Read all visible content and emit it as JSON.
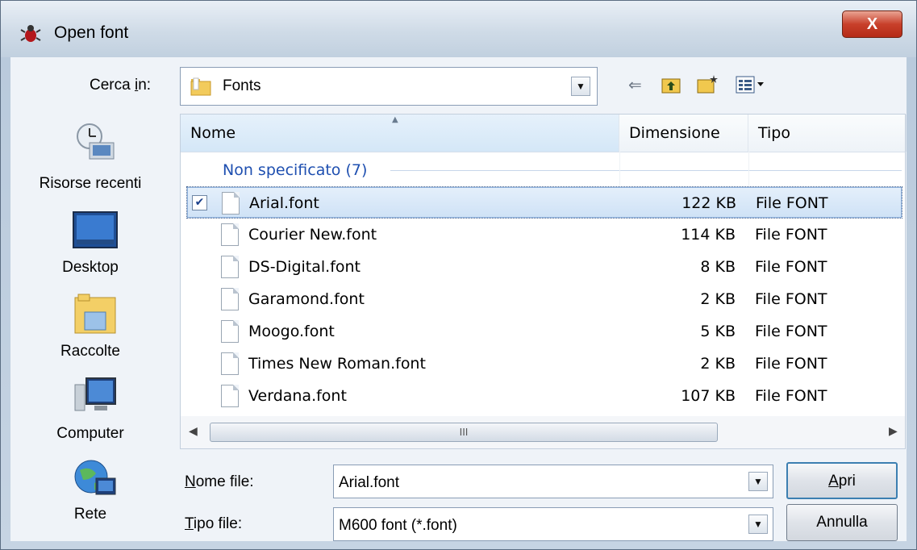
{
  "window": {
    "title": "Open font",
    "close_label": "X"
  },
  "toolbar": {
    "lookin_label_prefix": "Cerca ",
    "lookin_label_u": "i",
    "lookin_label_suffix": "n:",
    "lookin_value": "Fonts",
    "icons": [
      "back-arrow-icon",
      "up-folder-icon",
      "new-folder-icon",
      "view-menu-icon"
    ]
  },
  "places": [
    {
      "label": "Risorse recenti",
      "icon": "recent-places-icon"
    },
    {
      "label": "Desktop",
      "icon": "desktop-icon"
    },
    {
      "label": "Raccolte",
      "icon": "libraries-icon"
    },
    {
      "label": "Computer",
      "icon": "computer-icon"
    },
    {
      "label": "Rete",
      "icon": "network-icon"
    }
  ],
  "filelist": {
    "columns": [
      "Nome",
      "Dimensione",
      "Tipo"
    ],
    "group_label": "Non specificato (7)",
    "rows": [
      {
        "name": "Arial.font",
        "size": "122 KB",
        "type": "File FONT",
        "selected": true
      },
      {
        "name": "Courier New.font",
        "size": "114 KB",
        "type": "File FONT"
      },
      {
        "name": "DS-Digital.font",
        "size": "8 KB",
        "type": "File FONT"
      },
      {
        "name": "Garamond.font",
        "size": "2 KB",
        "type": "File FONT"
      },
      {
        "name": "Moogo.font",
        "size": "5 KB",
        "type": "File FONT"
      },
      {
        "name": "Times New Roman.font",
        "size": "2 KB",
        "type": "File FONT"
      },
      {
        "name": "Verdana.font",
        "size": "107 KB",
        "type": "File FONT"
      }
    ],
    "scroll_thumb_label": "III"
  },
  "footer": {
    "filename_label_u": "N",
    "filename_label_rest": "ome file:",
    "filename_value": "Arial.font",
    "filetype_label_u": "T",
    "filetype_label_rest": "ipo file:",
    "filetype_value": "M600 font (*.font)",
    "open_label_u": "A",
    "open_label_rest": "pri",
    "cancel_label": "Annulla"
  }
}
